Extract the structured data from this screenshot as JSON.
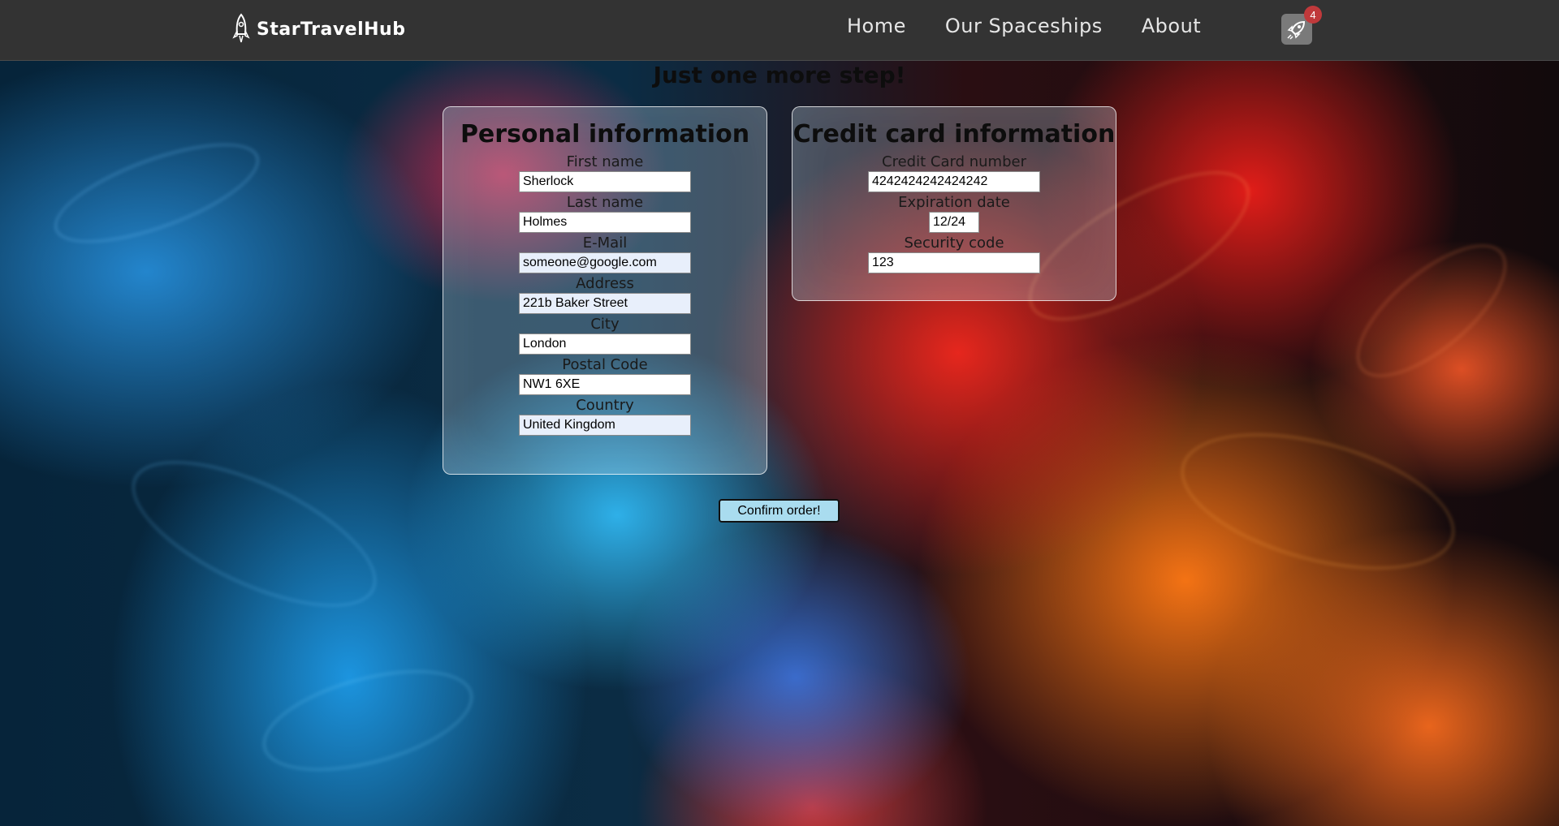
{
  "navbar": {
    "brand": "StarTravelHub",
    "links": [
      {
        "label": "Home"
      },
      {
        "label": "Our Spaceships"
      },
      {
        "label": "About"
      }
    ],
    "cart_count": "4"
  },
  "page": {
    "heading": "Just one more step!"
  },
  "personal": {
    "title": "Personal information",
    "fields": [
      {
        "label": "First name",
        "value": "Sherlock"
      },
      {
        "label": "Last name",
        "value": "Holmes"
      },
      {
        "label": "E-Mail",
        "value": "someone@google.com"
      },
      {
        "label": "Address",
        "value": "221b Baker Street"
      },
      {
        "label": "City",
        "value": "London"
      },
      {
        "label": "Postal Code",
        "value": "NW1 6XE"
      },
      {
        "label": "Country",
        "value": "United Kingdom"
      }
    ]
  },
  "credit": {
    "title": "Credit card information",
    "fields": [
      {
        "label": "Credit Card number",
        "value": "4242424242424242"
      },
      {
        "label": "Expiration date",
        "value": "12/24"
      },
      {
        "label": "Security code",
        "value": "123"
      }
    ]
  },
  "actions": {
    "confirm_label": "Confirm order!"
  },
  "colors": {
    "navbar": "#333333",
    "badge": "#c0393b",
    "button": "#a9dcef"
  },
  "icons": {
    "brand": "rocket-icon",
    "cart": "rocket-cart-icon"
  }
}
